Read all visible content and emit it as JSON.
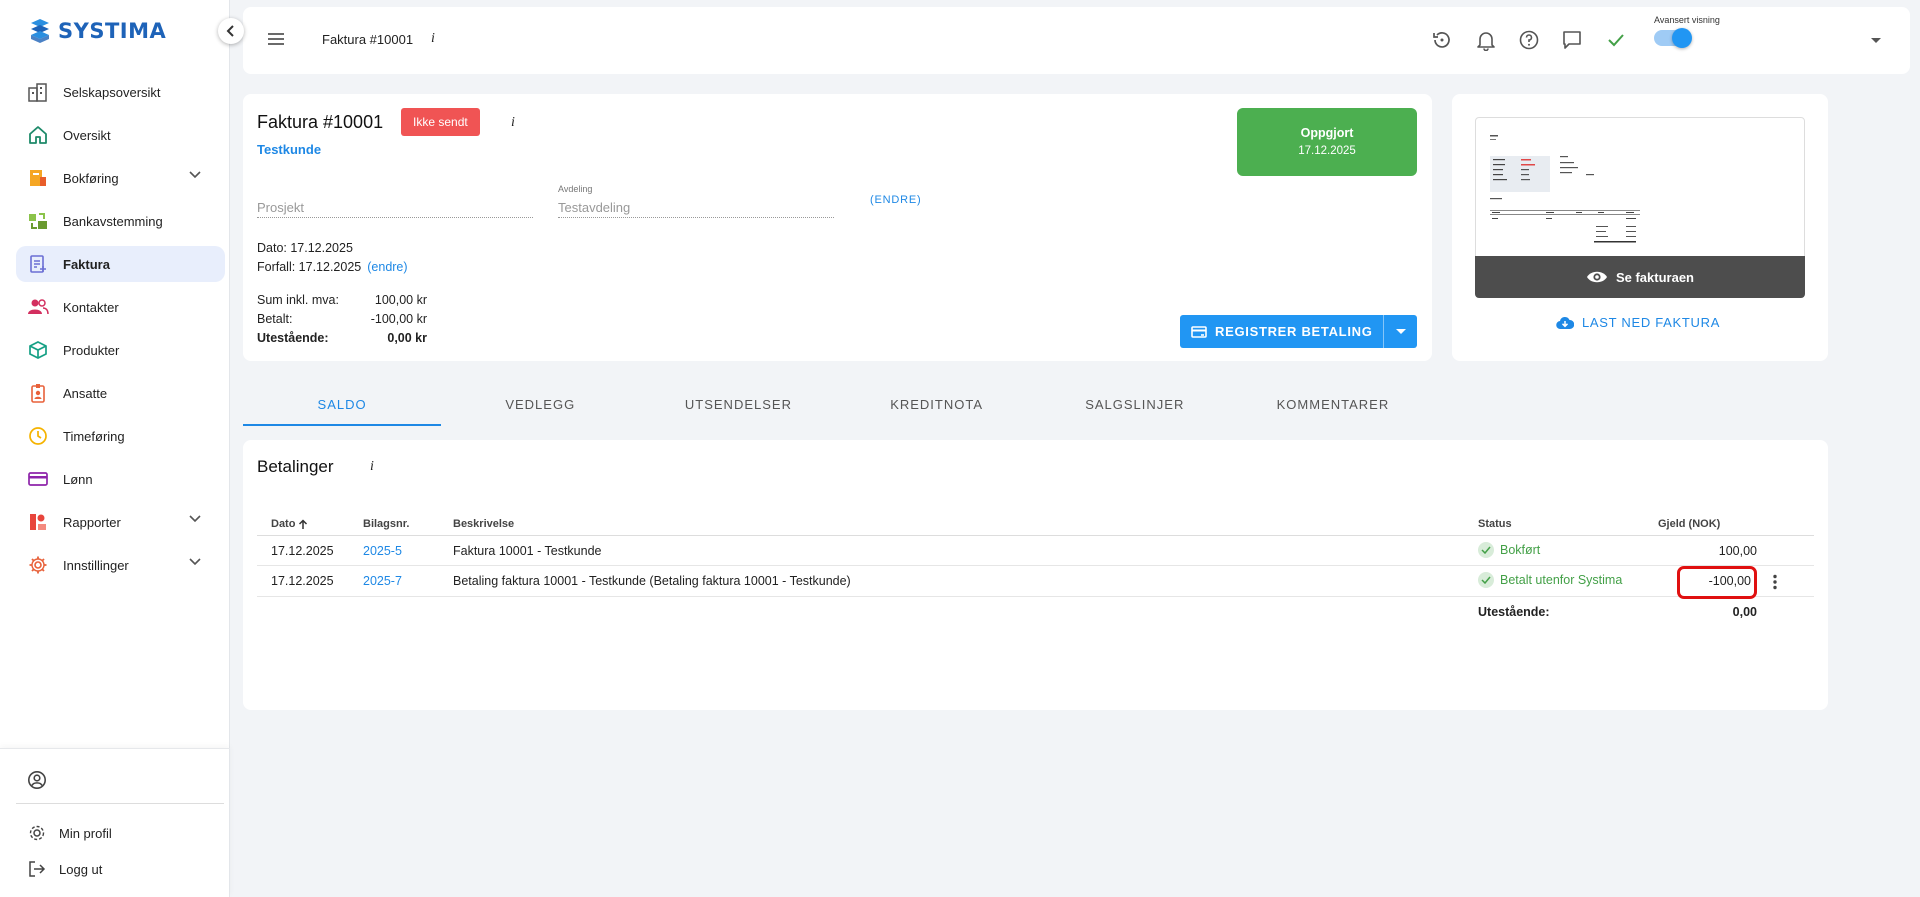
{
  "brand": {
    "name": "SYSTIMA",
    "color": "#1e63b8"
  },
  "sidebar": {
    "items": [
      {
        "label": "Selskapsoversikt",
        "icon": "building-icon"
      },
      {
        "label": "Oversikt",
        "icon": "home-icon"
      },
      {
        "label": "Bokføring",
        "icon": "bookkeeping-icon",
        "expandable": true
      },
      {
        "label": "Bankavstemming",
        "icon": "bank-reconcile-icon"
      },
      {
        "label": "Faktura",
        "icon": "invoice-icon",
        "active": true
      },
      {
        "label": "Kontakter",
        "icon": "contacts-icon"
      },
      {
        "label": "Produkter",
        "icon": "products-icon"
      },
      {
        "label": "Ansatte",
        "icon": "employees-icon"
      },
      {
        "label": "Timeføring",
        "icon": "clock-icon"
      },
      {
        "label": "Lønn",
        "icon": "payroll-card-icon"
      },
      {
        "label": "Rapporter",
        "icon": "reports-icon",
        "expandable": true
      },
      {
        "label": "Innstillinger",
        "icon": "settings-gear-icon",
        "expandable": true
      }
    ],
    "bottom": {
      "profile": "Min profil",
      "logout": "Logg ut"
    }
  },
  "topbar": {
    "title": "Faktura #10001",
    "info": "i",
    "advanced_label": "Avansert visning",
    "advanced_on": true
  },
  "invoice": {
    "title": "Faktura #10001",
    "status_badge": "Ikke sendt",
    "info": "i",
    "customer": "Testkunde",
    "project_placeholder": "Prosjekt",
    "department_label": "Avdeling",
    "department_value": "Testavdeling",
    "change_caps": "(ENDRE)",
    "date_line": "Dato: 17.12.2025",
    "due_line": "Forfall: 17.12.2025",
    "due_change": "(endre)",
    "sums": [
      {
        "label": "Sum inkl. mva:",
        "value": "100,00 kr"
      },
      {
        "label": "Betalt:",
        "value": "-100,00 kr"
      },
      {
        "label": "Utestående:",
        "value": "0,00 kr",
        "bold": true
      }
    ],
    "settled_title": "Oppgjort",
    "settled_date": "17.12.2025",
    "register_button": "REGISTRER BETALING"
  },
  "preview": {
    "view_label": "Se fakturaen",
    "download_label": "LAST NED FAKTURA"
  },
  "tabs": [
    "SALDO",
    "VEDLEGG",
    "UTSENDELSER",
    "KREDITNOTA",
    "SALGSLINJER",
    "KOMMENTARER"
  ],
  "payments": {
    "title": "Betalinger",
    "info": "i",
    "columns": {
      "date": "Dato",
      "voucher": "Bilagsnr.",
      "desc": "Beskrivelse",
      "status": "Status",
      "debt": "Gjeld (NOK)"
    },
    "rows": [
      {
        "date": "17.12.2025",
        "voucher": "2025-5",
        "desc": "Faktura 10001 - Testkunde",
        "status": "Bokført",
        "debt": "100,00"
      },
      {
        "date": "17.12.2025",
        "voucher": "2025-7",
        "desc": "Betaling faktura 10001 - Testkunde (Betaling faktura 10001 - Testkunde)",
        "status": "Betalt utenfor Systima",
        "debt": "-100,00"
      }
    ],
    "footer_label": "Utestående:",
    "footer_value": "0,00"
  }
}
